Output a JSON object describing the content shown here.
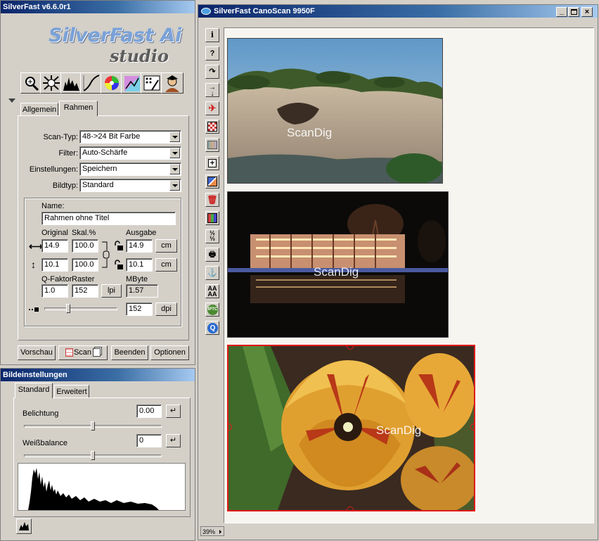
{
  "control_window": {
    "title": "SilverFast v6.6.0r1",
    "logo_line1": "SilverFast Ai",
    "logo_line2": "studio",
    "tabs": [
      "Allgemein",
      "Rahmen"
    ],
    "active_tab": "Rahmen",
    "scan_type_label": "Scan-Typ:",
    "scan_type_value": "48->24 Bit Farbe",
    "filter_label": "Filter:",
    "filter_value": "Auto-Schärfe",
    "settings_label": "Einstellungen:",
    "settings_value": "Speichern",
    "image_type_label": "Bildtyp:",
    "image_type_value": "Standard",
    "name_label": "Name:",
    "name_value": "Rahmen ohne Titel",
    "col_original": "Original",
    "col_scale": "Skal.%",
    "col_output": "Ausgabe",
    "width_original": "14.9",
    "width_scale": "100.0",
    "width_output": "14.9",
    "height_original": "10.1",
    "height_scale": "100.0",
    "height_output": "10.1",
    "unit_width": "cm",
    "unit_height": "cm",
    "qfactor_label": "Q-Faktor",
    "raster_label": "Raster",
    "mbyte_label": "MByte",
    "qfactor_value": "1.0",
    "raster_value": "152",
    "raster_unit": "lpi",
    "mbyte_value": "1.57",
    "dpi_value": "152",
    "dpi_unit": "dpi",
    "buttons": {
      "preview": "Vorschau",
      "scan": "Scan",
      "quit": "Beenden",
      "options": "Optionen"
    }
  },
  "image_settings": {
    "title": "Bildeinstellungen",
    "tabs": [
      "Standard",
      "Erweitert"
    ],
    "active_tab": "Standard",
    "exposure_label": "Belichtung",
    "exposure_value": "0.00",
    "white_balance_label": "Weißbalance",
    "white_balance_value": "0"
  },
  "preview_window": {
    "title": "SilverFast CanoScan 9950F",
    "zoom": "39%",
    "watermarks": [
      "ScanDig",
      "ScanDig",
      "ScanDig"
    ],
    "toolbar_tips": [
      "i",
      "?"
    ]
  },
  "sliders": {
    "dpi_slider_fraction": 0.33,
    "exposure_fraction": 0.5,
    "white_balance_fraction": 0.5
  },
  "colors": {
    "title_active": "#0a246a",
    "frame_selected": "#e01818",
    "face": "#d4d0c8"
  }
}
